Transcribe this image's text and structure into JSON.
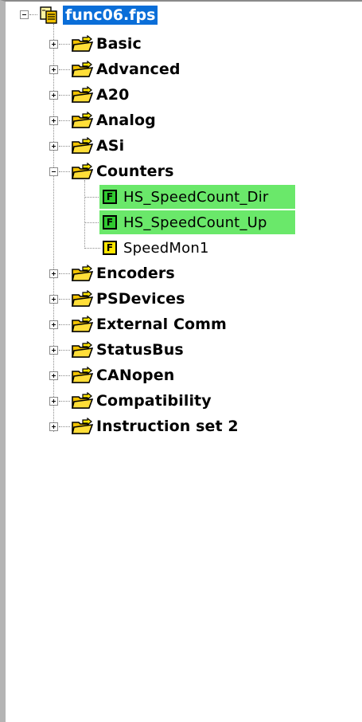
{
  "tree": {
    "root": {
      "label": "func06.fps",
      "expanded": true,
      "icon": "project-file-icon"
    },
    "folders_before": [
      {
        "label": "Basic",
        "expanded": false
      },
      {
        "label": "Advanced",
        "expanded": false
      },
      {
        "label": "A20",
        "expanded": false
      },
      {
        "label": "Analog",
        "expanded": false
      },
      {
        "label": "ASi",
        "expanded": false
      }
    ],
    "counters": {
      "label": "Counters",
      "expanded": true,
      "children": [
        {
          "label": "HS_SpeedCount_Dir",
          "icon_text": "F",
          "icon_color": "#2fc92f",
          "highlight": "#6ae86a"
        },
        {
          "label": "HS_SpeedCount_Up",
          "icon_text": "F",
          "icon_color": "#2fc92f",
          "highlight": "#6ae86a"
        },
        {
          "label": "SpeedMon1",
          "icon_text": "F",
          "icon_color": "#ffe600",
          "highlight": ""
        }
      ]
    },
    "folders_after": [
      {
        "label": "Encoders",
        "expanded": false
      },
      {
        "label": "PSDevices",
        "expanded": false
      },
      {
        "label": "External Comm",
        "expanded": false
      },
      {
        "label": "StatusBus",
        "expanded": false
      },
      {
        "label": "CANopen",
        "expanded": false
      },
      {
        "label": "Compatibility",
        "expanded": false
      },
      {
        "label": "Instruction set 2",
        "expanded": false
      }
    ]
  },
  "colors": {
    "selection": "#0a6ed8",
    "highlight": "#6ae86a",
    "fb_green": "#2fc92f",
    "fb_yellow": "#ffe600"
  }
}
